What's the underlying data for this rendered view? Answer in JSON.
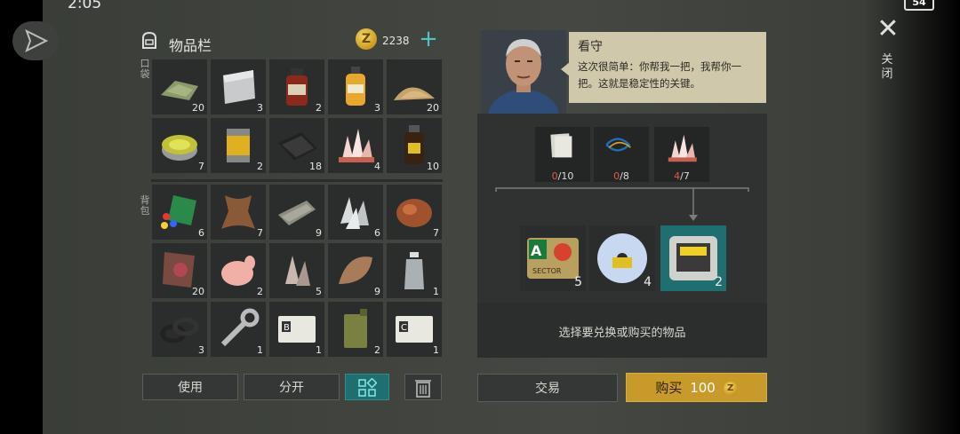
{
  "status": {
    "time": "2:05",
    "battery": "54"
  },
  "inventory": {
    "title": "物品栏",
    "coins": "2238",
    "pocket_label": "口袋",
    "backpack_label": "背包",
    "pocket": [
      {
        "icon": "cloth-icon",
        "count": "20"
      },
      {
        "icon": "metal-sheet-icon",
        "count": "3"
      },
      {
        "icon": "red-bottle-icon",
        "count": "2"
      },
      {
        "icon": "yellow-bottle-icon",
        "count": "3"
      },
      {
        "icon": "sand-pile-icon",
        "count": "20"
      },
      {
        "icon": "ointment-tin-icon",
        "count": "7"
      },
      {
        "icon": "filter-icon",
        "count": "2"
      },
      {
        "icon": "leather-fabric-icon",
        "count": "18"
      },
      {
        "icon": "crystal-icon",
        "count": "4"
      },
      {
        "icon": "dark-vial-icon",
        "count": "10"
      }
    ],
    "backpack": [
      {
        "icon": "pills-book-icon",
        "count": "6"
      },
      {
        "icon": "animal-hide-icon",
        "count": "7"
      },
      {
        "icon": "scrap-paper-icon",
        "count": "9"
      },
      {
        "icon": "quartz-icon",
        "count": "6"
      },
      {
        "icon": "copper-ore-icon",
        "count": "7"
      },
      {
        "icon": "raw-hide-icon",
        "count": "20"
      },
      {
        "icon": "raw-chicken-icon",
        "count": "2"
      },
      {
        "icon": "rock-crystal-icon",
        "count": "5"
      },
      {
        "icon": "fur-icon",
        "count": "9"
      },
      {
        "icon": "plastic-bottle-icon",
        "count": "1"
      },
      {
        "icon": "rubber-rings-icon",
        "count": "3"
      },
      {
        "icon": "wrench-icon",
        "count": "1"
      },
      {
        "icon": "access-card-b-icon",
        "count": "1"
      },
      {
        "icon": "jerrycan-icon",
        "count": "2"
      },
      {
        "icon": "access-card-c-icon",
        "count": "1"
      }
    ],
    "buttons": {
      "use": "使用",
      "split": "分开"
    }
  },
  "trader": {
    "name": "看守",
    "dialogue": "这次很简单：你帮我一把，我帮你一把。这就是稳定性的关键。",
    "requirements": [
      {
        "icon": "papers-icon",
        "have": "0",
        "need": "/10"
      },
      {
        "icon": "wires-icon",
        "have": "0",
        "need": "/8"
      },
      {
        "icon": "crystal-icon",
        "have": "4",
        "need": "/7"
      }
    ],
    "rewards": [
      {
        "icon": "sector-keycard-icon",
        "count": "5",
        "card_letter": "A",
        "card_text": "SECTOR"
      },
      {
        "icon": "data-disc-icon",
        "count": "4"
      },
      {
        "icon": "device-icon",
        "count": "2"
      }
    ],
    "hint": "选择要兑换或购买的物品",
    "trade_label": "交易",
    "buy_label": "购买",
    "buy_price": "100"
  },
  "close_label": "关闭",
  "colors": {
    "accent": "#1f6f70",
    "gold": "#c79a2a",
    "need_red": "#e05a4a"
  }
}
